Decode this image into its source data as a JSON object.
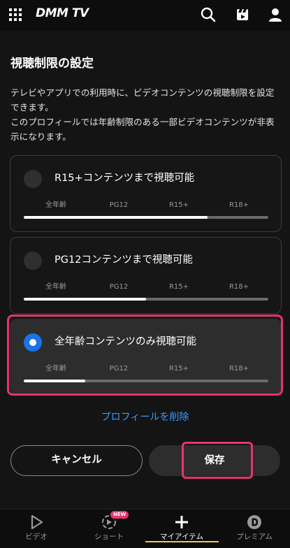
{
  "header": {
    "logo": "DMM TV",
    "icons": [
      "menu-grid-icon",
      "search-icon",
      "clapperboard-icon",
      "user-icon"
    ]
  },
  "page": {
    "title": "視聴制限の設定",
    "description_lines": [
      "テレビやアプリでの利用時に、ビデオコンテンツの視聴制限を設定",
      "できます。",
      "このプロフィールでは年齢制限のある一部ビデオコンテンツが非表",
      "示になります。"
    ]
  },
  "ticks": [
    "全年齢",
    "PG12",
    "R15+",
    "R18+"
  ],
  "options": [
    {
      "label": "R15+コンテンツまで視聴可能",
      "selected": false,
      "level": 0.75
    },
    {
      "label": "PG12コンテンツまで視聴可能",
      "selected": false,
      "level": 0.5
    },
    {
      "label": "全年齢コンテンツのみ視聴可能",
      "selected": true,
      "level": 0.25
    }
  ],
  "delete_link": "プロフィールを削除",
  "buttons": {
    "cancel": "キャンセル",
    "save": "保存"
  },
  "nav": {
    "items": [
      {
        "label": "ビデオ",
        "icon": "play-icon",
        "active": false
      },
      {
        "label": "ショート",
        "icon": "shorts-icon",
        "active": false,
        "badge": "NEW"
      },
      {
        "label": "マイアイテム",
        "icon": "plus-icon",
        "active": true
      },
      {
        "label": "プレミアム",
        "icon": "premium-icon",
        "active": false
      }
    ]
  },
  "colors": {
    "accent_blue": "#1a73e8",
    "link_blue": "#3b9bff",
    "highlight_pink": "#e8336e",
    "active_bar": "#f2c94c"
  }
}
